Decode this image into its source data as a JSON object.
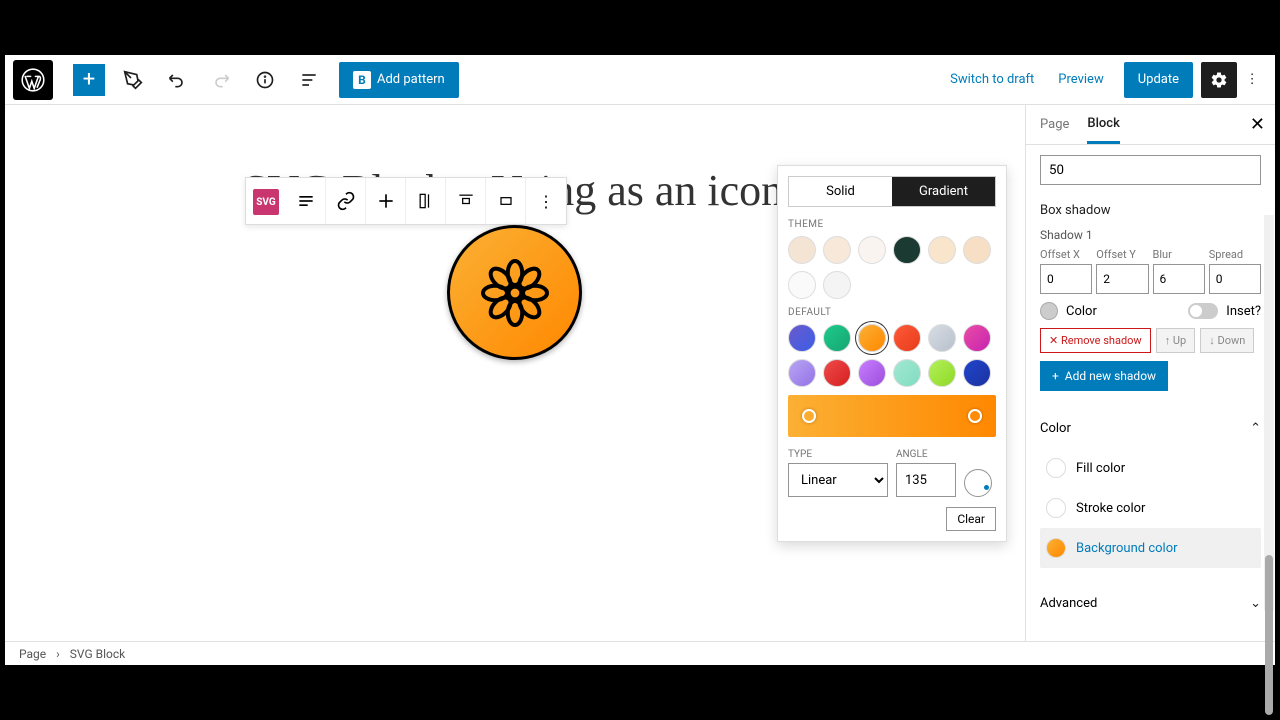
{
  "topbar": {
    "add_pattern": "Add pattern",
    "switch_draft": "Switch to draft",
    "preview": "Preview",
    "update": "Update"
  },
  "canvas": {
    "page_title": "SVG Block – Using as an icon"
  },
  "color_popup": {
    "tab_solid": "Solid",
    "tab_gradient": "Gradient",
    "theme_label": "THEME",
    "default_label": "DEFAULT",
    "type_label": "TYPE",
    "type_value": "Linear",
    "angle_label": "ANGLE",
    "angle_value": "135",
    "clear": "Clear",
    "theme_swatches": [
      "#f4e4d4",
      "#f7e8d9",
      "#f9f4ef",
      "#1a3a32",
      "#f8e5cc",
      "#f6dfc4",
      "#fafafa",
      "#f4f4f4"
    ],
    "default_swatches": [
      "linear-gradient(135deg,#6a5acd,#3b5ee6)",
      "linear-gradient(135deg,#1ecb8b,#16a571)",
      "linear-gradient(135deg,#fbb034,#ff8800)",
      "linear-gradient(135deg,#ff5a36,#e73c1e)",
      "linear-gradient(135deg,#d7dde4,#b7c0cc)",
      "linear-gradient(135deg,#e94ca4,#c724b1)",
      "linear-gradient(135deg,#b8a6f4,#9472e6)",
      "linear-gradient(135deg,#ef4a4a,#d62020)",
      "linear-gradient(135deg,#c77dff,#9d4edd)",
      "linear-gradient(135deg,#a3e8d2,#7fdcc0)",
      "linear-gradient(135deg,#b3f05a,#8fd926)",
      "linear-gradient(135deg,#2244cc,#1a33a0)"
    ],
    "selected_default_index": 2
  },
  "sidebar": {
    "tab_page": "Page",
    "tab_block": "Block",
    "top_value": "50",
    "box_shadow": "Box shadow",
    "shadow1": "Shadow 1",
    "offset_x_label": "Offset X",
    "offset_y_label": "Offset Y",
    "blur_label": "Blur",
    "spread_label": "Spread",
    "offset_x": "0",
    "offset_y": "2",
    "blur": "6",
    "spread": "0",
    "color_label": "Color",
    "inset_label": "Inset?",
    "remove_shadow": "Remove shadow",
    "up": "Up",
    "down": "Down",
    "add_shadow": "Add new shadow",
    "color_section": "Color",
    "fill_color": "Fill color",
    "stroke_color": "Stroke color",
    "bg_color": "Background color",
    "advanced": "Advanced"
  },
  "breadcrumb": {
    "page": "Page",
    "block": "SVG Block"
  }
}
